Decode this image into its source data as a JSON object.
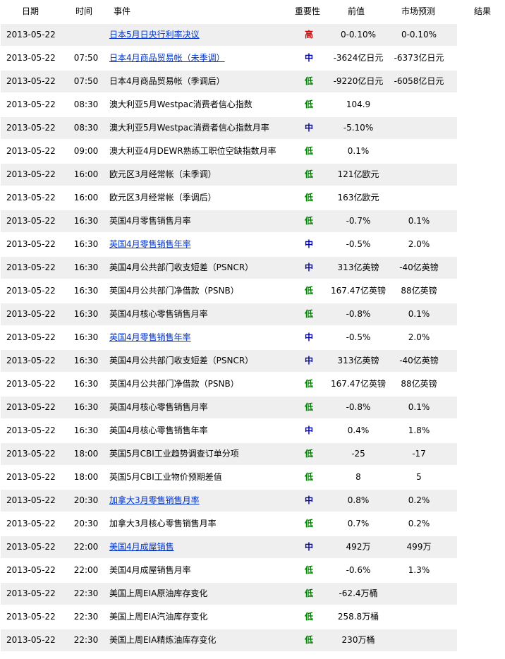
{
  "header": {
    "date": "日期",
    "time": "时间",
    "event": "事件",
    "importance": "重要性",
    "previous": "前值",
    "forecast": "市场预测",
    "result": "结果"
  },
  "colors": {
    "high": "#cc0000",
    "medium": "#0000aa",
    "low": "#007f00",
    "link": "#0033cc",
    "row_alt": "#efefef"
  },
  "rows": [
    {
      "date": "2013-05-22",
      "time": "",
      "event": "日本5月日央行利率决议",
      "link": true,
      "importance": "高",
      "level": "high",
      "previous": "0-0.10%",
      "forecast": "0-0.10%"
    },
    {
      "date": "2013-05-22",
      "time": "07:50",
      "event": "日本4月商品贸易帐（未季调）",
      "link": true,
      "importance": "中",
      "level": "mid",
      "previous": "-3624亿日元",
      "forecast": "-6373亿日元"
    },
    {
      "date": "2013-05-22",
      "time": "07:50",
      "event": "日本4月商品贸易帐（季调后）",
      "link": false,
      "importance": "低",
      "level": "low",
      "previous": "-9220亿日元",
      "forecast": "-6058亿日元"
    },
    {
      "date": "2013-05-22",
      "time": "08:30",
      "event": "澳大利亚5月Westpac消费者信心指数",
      "link": false,
      "importance": "低",
      "level": "low",
      "previous": "104.9",
      "forecast": ""
    },
    {
      "date": "2013-05-22",
      "time": "08:30",
      "event": "澳大利亚5月Westpac消费者信心指数月率",
      "link": false,
      "importance": "中",
      "level": "mid",
      "previous": "-5.10%",
      "forecast": ""
    },
    {
      "date": "2013-05-22",
      "time": "09:00",
      "event": "澳大利亚4月DEWR熟练工职位空缺指数月率",
      "link": false,
      "importance": "低",
      "level": "low",
      "previous": "0.1%",
      "forecast": ""
    },
    {
      "date": "2013-05-22",
      "time": "16:00",
      "event": "欧元区3月经常帐（未季调）",
      "link": false,
      "importance": "低",
      "level": "low",
      "previous": "121亿欧元",
      "forecast": ""
    },
    {
      "date": "2013-05-22",
      "time": "16:00",
      "event": "欧元区3月经常帐（季调后）",
      "link": false,
      "importance": "低",
      "level": "low",
      "previous": "163亿欧元",
      "forecast": ""
    },
    {
      "date": "2013-05-22",
      "time": "16:30",
      "event": "英国4月零售销售月率",
      "link": false,
      "importance": "低",
      "level": "low",
      "previous": "-0.7%",
      "forecast": "0.1%"
    },
    {
      "date": "2013-05-22",
      "time": "16:30",
      "event": "英国4月零售销售年率",
      "link": true,
      "importance": "中",
      "level": "mid",
      "previous": "-0.5%",
      "forecast": "2.0%"
    },
    {
      "date": "2013-05-22",
      "time": "16:30",
      "event": "英国4月公共部门收支短差（PSNCR）",
      "link": false,
      "importance": "中",
      "level": "mid",
      "previous": "313亿英镑",
      "forecast": "-40亿英镑"
    },
    {
      "date": "2013-05-22",
      "time": "16:30",
      "event": "英国4月公共部门净借款（PSNB）",
      "link": false,
      "importance": "低",
      "level": "low",
      "previous": "167.47亿英镑",
      "forecast": "88亿英镑"
    },
    {
      "date": "2013-05-22",
      "time": "16:30",
      "event": "英国4月核心零售销售月率",
      "link": false,
      "importance": "低",
      "level": "low",
      "previous": "-0.8%",
      "forecast": "0.1%"
    },
    {
      "date": "2013-05-22",
      "time": "16:30",
      "event": "英国4月零售销售年率",
      "link": true,
      "importance": "中",
      "level": "mid",
      "previous": "-0.5%",
      "forecast": "2.0%"
    },
    {
      "date": "2013-05-22",
      "time": "16:30",
      "event": "英国4月公共部门收支短差（PSNCR）",
      "link": false,
      "importance": "中",
      "level": "mid",
      "previous": "313亿英镑",
      "forecast": "-40亿英镑"
    },
    {
      "date": "2013-05-22",
      "time": "16:30",
      "event": "英国4月公共部门净借款（PSNB）",
      "link": false,
      "importance": "低",
      "level": "low",
      "previous": "167.47亿英镑",
      "forecast": "88亿英镑"
    },
    {
      "date": "2013-05-22",
      "time": "16:30",
      "event": "英国4月核心零售销售月率",
      "link": false,
      "importance": "低",
      "level": "low",
      "previous": "-0.8%",
      "forecast": "0.1%"
    },
    {
      "date": "2013-05-22",
      "time": "16:30",
      "event": "英国4月核心零售销售年率",
      "link": false,
      "importance": "中",
      "level": "mid",
      "previous": "0.4%",
      "forecast": "1.8%"
    },
    {
      "date": "2013-05-22",
      "time": "18:00",
      "event": "英国5月CBI工业趋势调查订单分项",
      "link": false,
      "importance": "低",
      "level": "low",
      "previous": "-25",
      "forecast": "-17"
    },
    {
      "date": "2013-05-22",
      "time": "18:00",
      "event": "英国5月CBI工业物价预期差值",
      "link": false,
      "importance": "低",
      "level": "low",
      "previous": "8",
      "forecast": "5"
    },
    {
      "date": "2013-05-22",
      "time": "20:30",
      "event": "加拿大3月零售销售月率",
      "link": true,
      "importance": "中",
      "level": "mid",
      "previous": "0.8%",
      "forecast": "0.2%"
    },
    {
      "date": "2013-05-22",
      "time": "20:30",
      "event": "加拿大3月核心零售销售月率",
      "link": false,
      "importance": "低",
      "level": "low",
      "previous": "0.7%",
      "forecast": "0.2%"
    },
    {
      "date": "2013-05-22",
      "time": "22:00",
      "event": "美国4月成屋销售",
      "link": true,
      "importance": "中",
      "level": "mid",
      "previous": "492万",
      "forecast": "499万"
    },
    {
      "date": "2013-05-22",
      "time": "22:00",
      "event": "美国4月成屋销售月率",
      "link": false,
      "importance": "低",
      "level": "low",
      "previous": "-0.6%",
      "forecast": "1.3%"
    },
    {
      "date": "2013-05-22",
      "time": "22:30",
      "event": "美国上周EIA原油库存变化",
      "link": false,
      "importance": "低",
      "level": "low",
      "previous": "-62.4万桶",
      "forecast": ""
    },
    {
      "date": "2013-05-22",
      "time": "22:30",
      "event": "美国上周EIA汽油库存变化",
      "link": false,
      "importance": "低",
      "level": "low",
      "previous": "258.8万桶",
      "forecast": ""
    },
    {
      "date": "2013-05-22",
      "time": "22:30",
      "event": "美国上周EIA精炼油库存变化",
      "link": false,
      "importance": "低",
      "level": "low",
      "previous": "230万桶",
      "forecast": ""
    }
  ]
}
